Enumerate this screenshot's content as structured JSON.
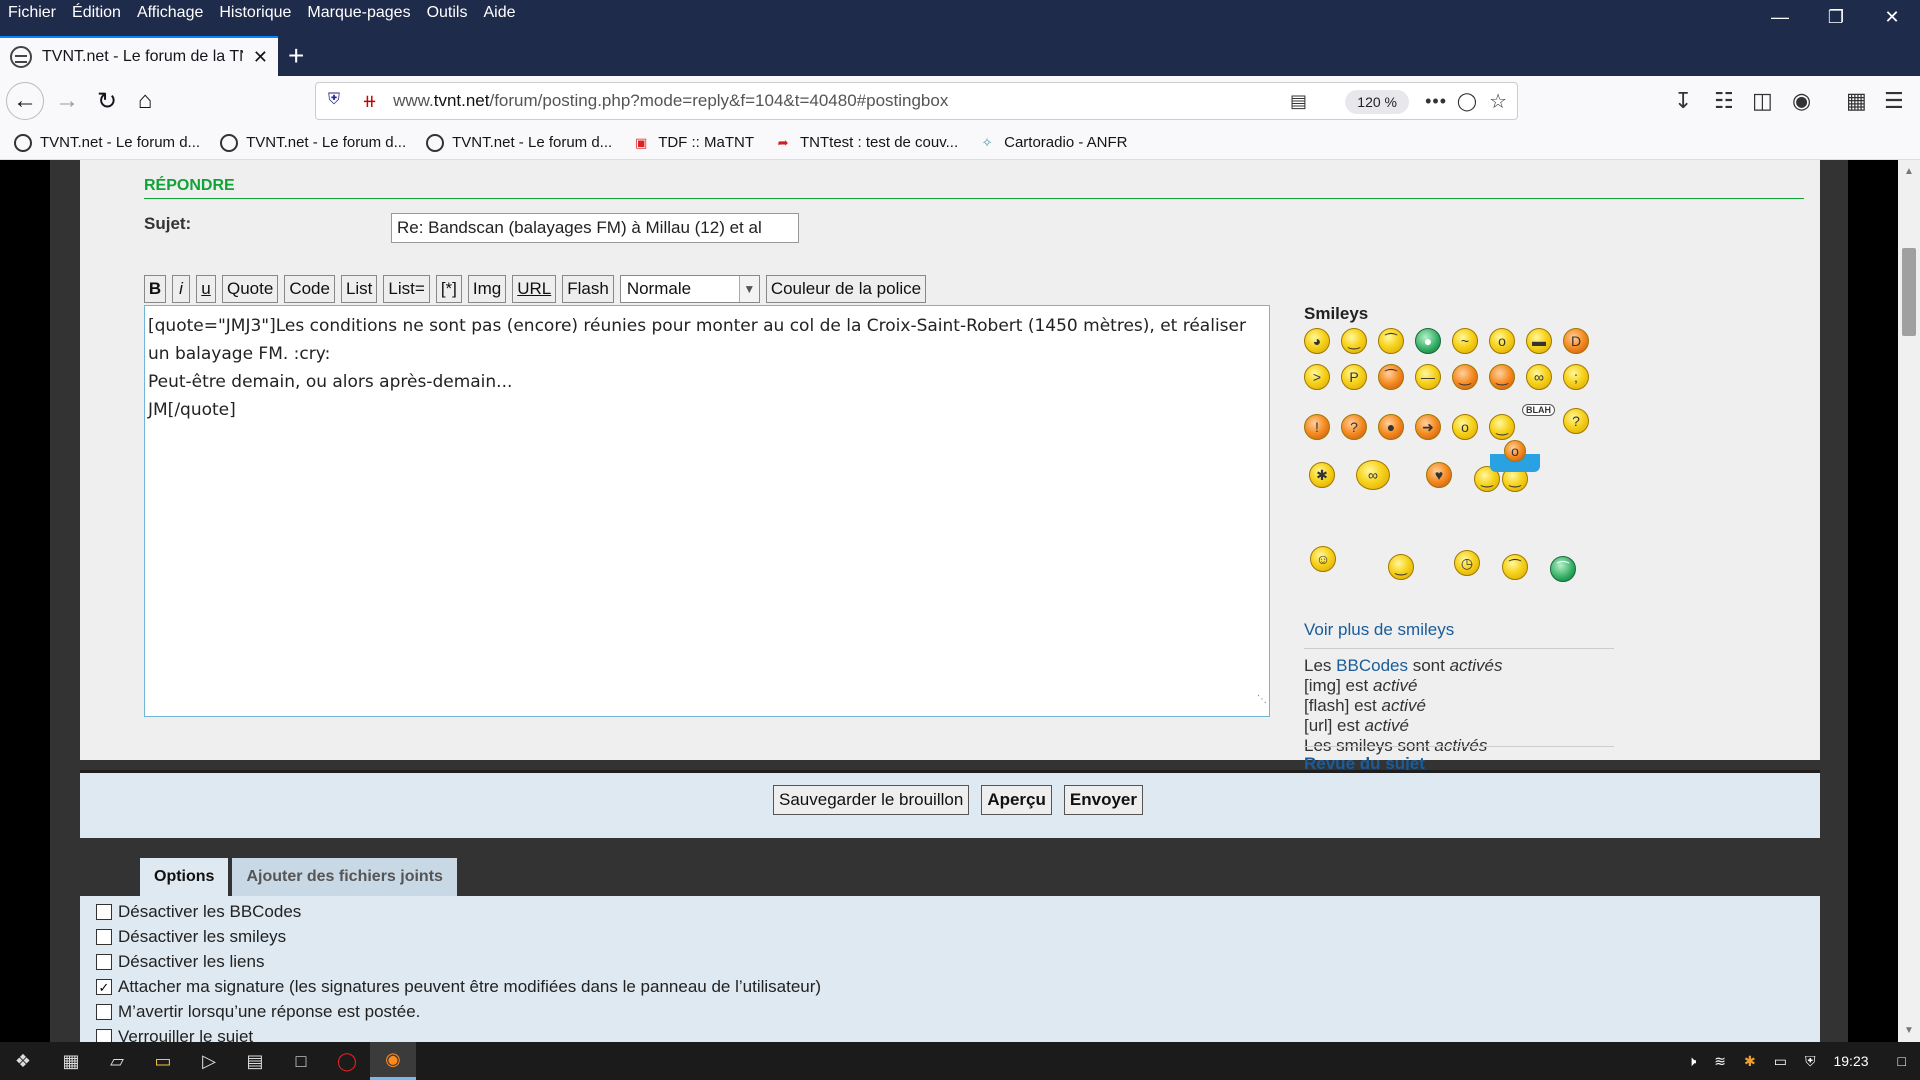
{
  "menubar": {
    "items": [
      "Fichier",
      "Édition",
      "Affichage",
      "Historique",
      "Marque-pages",
      "Outils",
      "Aide"
    ]
  },
  "tab": {
    "title": "TVNT.net - Le forum de la TNT"
  },
  "navbar": {
    "url_prefix": "www.",
    "url_domain": "tvnt.net",
    "url_path": "/forum/posting.php?mode=reply&f=104&t=40480#postingbox",
    "zoom": "120 %"
  },
  "bookmarks": [
    {
      "label": "TVNT.net - Le forum d...",
      "icon": "globe-icon"
    },
    {
      "label": "TVNT.net - Le forum d...",
      "icon": "globe-icon"
    },
    {
      "label": "TVNT.net - Le forum d...",
      "icon": "globe-icon"
    },
    {
      "label": "TDF :: MaTNT",
      "icon": "tv-icon"
    },
    {
      "label": "TNTtest : test de couv...",
      "icon": "tnt-icon"
    },
    {
      "label": "Cartoradio - ANFR",
      "icon": "antenna-icon"
    }
  ],
  "form": {
    "heading": "RÉPONDRE",
    "subject_label": "Sujet:",
    "subject_value": "Re: Bandscan (balayages FM) à Millau (12) et al",
    "toolbar": {
      "bold": "B",
      "italic": "i",
      "underline": "u",
      "quote": "Quote",
      "code": "Code",
      "list": "List",
      "list_eq": "List=",
      "star": "[*]",
      "img": "Img",
      "url": "URL",
      "flash": "Flash",
      "size_value": "Normale",
      "color": "Couleur de la police"
    },
    "message_line1": "[quote=\"JMJ3\"]Les conditions ne sont pas (encore) réunies pour monter au col de la Croix-Saint-Robert (1450 mètres), et réaliser un balayage FM. :cry:",
    "message_line2": "Peut-être demain, ou alors après-demain...",
    "message_line3": "JM[/quote]"
  },
  "sidebar": {
    "smileys_title": "Smileys",
    "blah": "BLAH",
    "more_smileys": "Voir plus de smileys",
    "bb_les": "Les",
    "bb_link": "BBCodes",
    "bb_sont": "sont",
    "bb_active": "activés",
    "img_label": "[img] est",
    "img_state": "activé",
    "flash_label": "[flash] est",
    "flash_state": "activé",
    "url_label": "[url] est",
    "url_state": "activé",
    "smileys_label": "Les smileys sont",
    "smileys_state": "activés",
    "revue": "Revue du sujet"
  },
  "actions": {
    "draft": "Sauvegarder le brouillon",
    "preview": "Aperçu",
    "send": "Envoyer"
  },
  "options_tabs": {
    "options": "Options",
    "attachments": "Ajouter des fichiers joints"
  },
  "options": [
    {
      "label": "Désactiver les BBCodes",
      "checked": false
    },
    {
      "label": "Désactiver les smileys",
      "checked": false
    },
    {
      "label": "Désactiver les liens",
      "checked": false
    },
    {
      "label": "Attacher ma signature (les signatures peuvent être modifiées dans le panneau de l’utilisateur)",
      "checked": true
    },
    {
      "label": "M’avertir lorsqu’une réponse est postée.",
      "checked": false
    },
    {
      "label": "Verrouiller le sujet",
      "checked": false
    }
  ],
  "taskbar": {
    "time": "19:23"
  }
}
